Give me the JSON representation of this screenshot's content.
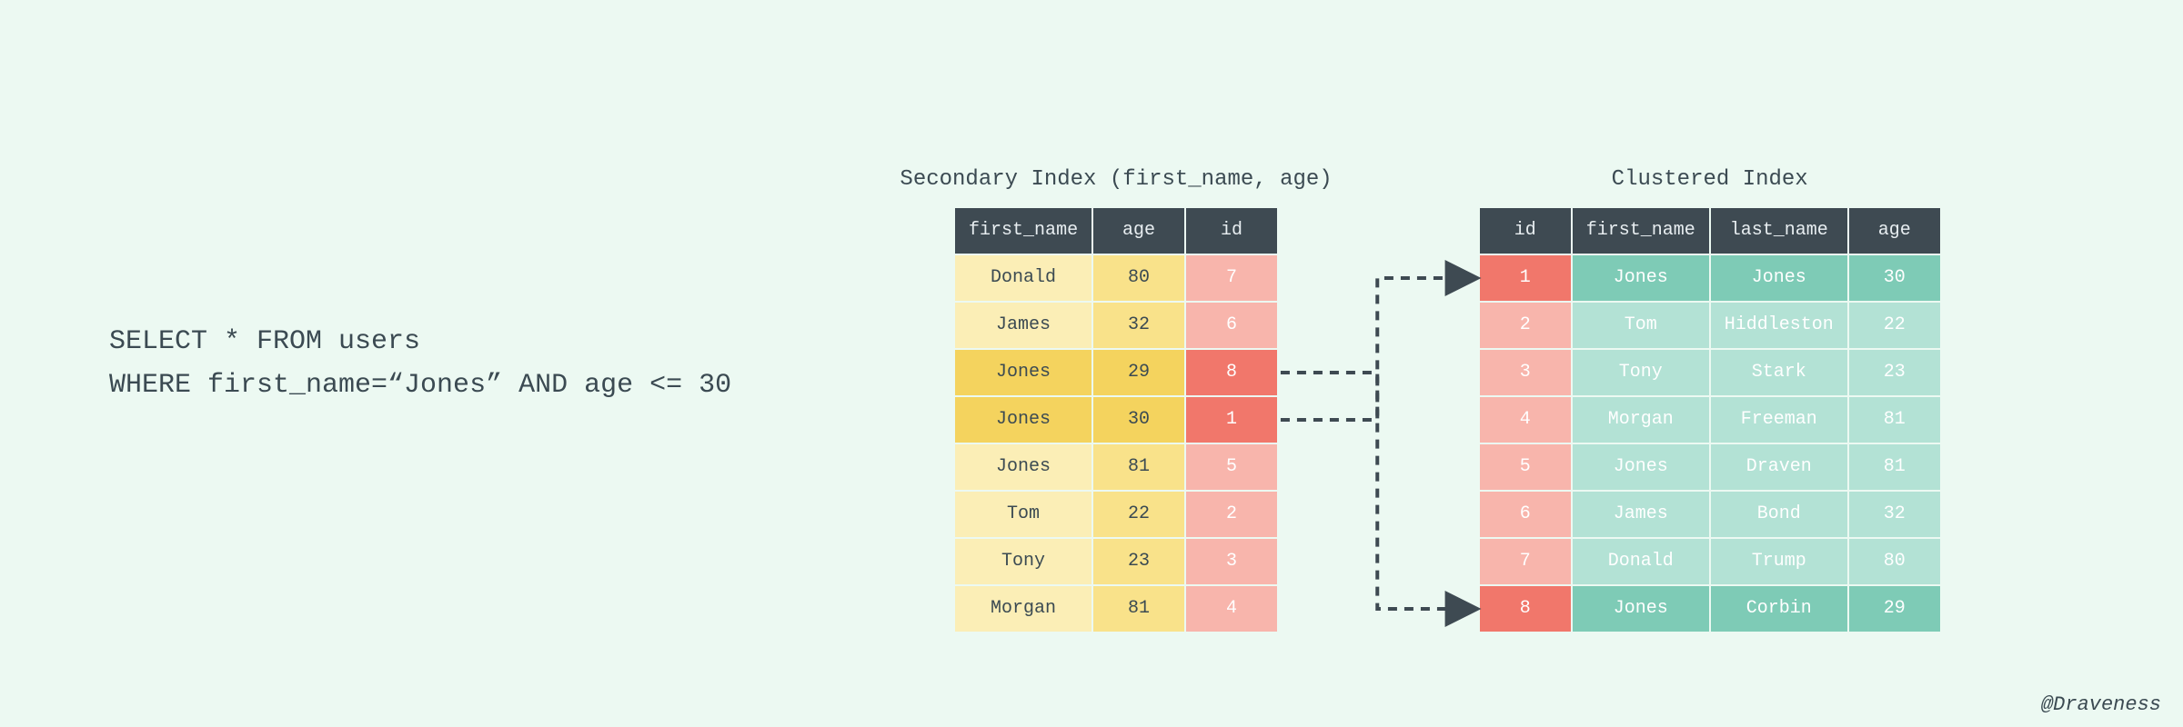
{
  "query": {
    "line1": "SELECT * FROM users",
    "line2": "WHERE first_name=“Jones” AND age <= 30"
  },
  "secondary_index": {
    "title": "Secondary Index (first_name, age)",
    "headers": [
      "first_name",
      "age",
      "id"
    ],
    "rows": [
      {
        "first_name": "Donald",
        "age": "80",
        "id": "7",
        "highlight": false
      },
      {
        "first_name": "James",
        "age": "32",
        "id": "6",
        "highlight": false
      },
      {
        "first_name": "Jones",
        "age": "29",
        "id": "8",
        "highlight": true
      },
      {
        "first_name": "Jones",
        "age": "30",
        "id": "1",
        "highlight": true
      },
      {
        "first_name": "Jones",
        "age": "81",
        "id": "5",
        "highlight": false
      },
      {
        "first_name": "Tom",
        "age": "22",
        "id": "2",
        "highlight": false
      },
      {
        "first_name": "Tony",
        "age": "23",
        "id": "3",
        "highlight": false
      },
      {
        "first_name": "Morgan",
        "age": "81",
        "id": "4",
        "highlight": false
      }
    ]
  },
  "clustered_index": {
    "title": "Clustered Index",
    "headers": [
      "id",
      "first_name",
      "last_name",
      "age"
    ],
    "rows": [
      {
        "id": "1",
        "first_name": "Jones",
        "last_name": "Jones",
        "age": "30",
        "highlight": true
      },
      {
        "id": "2",
        "first_name": "Tom",
        "last_name": "Hiddleston",
        "age": "22",
        "highlight": false
      },
      {
        "id": "3",
        "first_name": "Tony",
        "last_name": "Stark",
        "age": "23",
        "highlight": false
      },
      {
        "id": "4",
        "first_name": "Morgan",
        "last_name": "Freeman",
        "age": "81",
        "highlight": false
      },
      {
        "id": "5",
        "first_name": "Jones",
        "last_name": "Draven",
        "age": "81",
        "highlight": false
      },
      {
        "id": "6",
        "first_name": "James",
        "last_name": "Bond",
        "age": "32",
        "highlight": false
      },
      {
        "id": "7",
        "first_name": "Donald",
        "last_name": "Trump",
        "age": "80",
        "highlight": false
      },
      {
        "id": "8",
        "first_name": "Jones",
        "last_name": "Corbin",
        "age": "29",
        "highlight": true
      }
    ]
  },
  "links": [
    {
      "from_secondary_row": 2,
      "to_clustered_row": 7
    },
    {
      "from_secondary_row": 3,
      "to_clustered_row": 0
    }
  ],
  "credit": "@Draveness"
}
